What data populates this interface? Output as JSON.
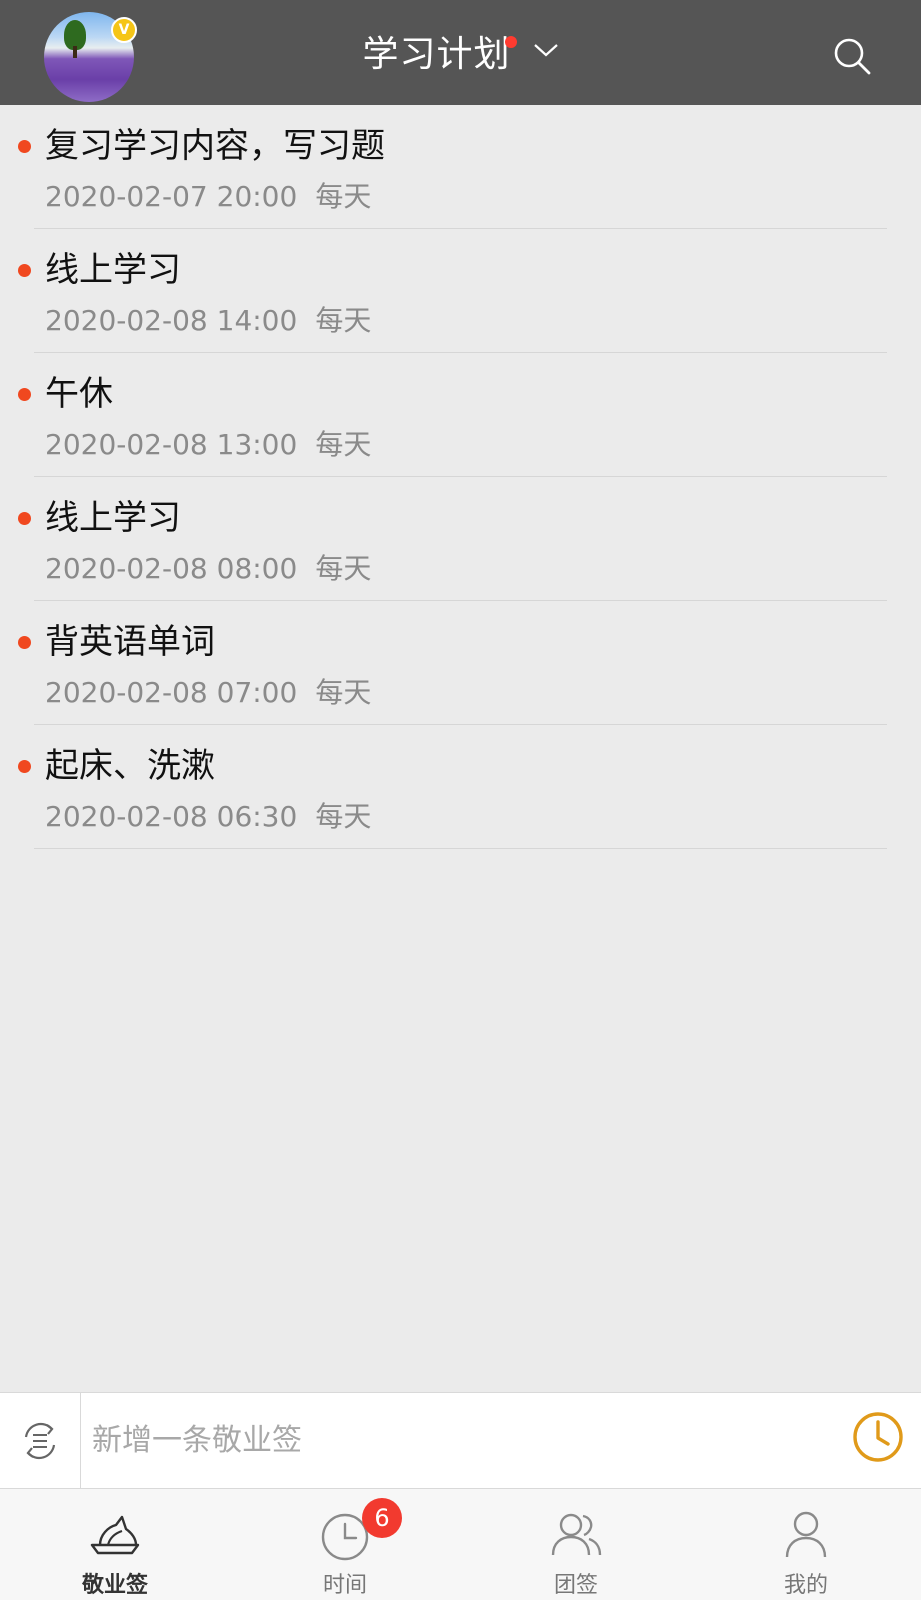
{
  "header": {
    "title": "学习计划",
    "vip_badge": "V"
  },
  "list": {
    "items": [
      {
        "title": "复习学习内容，写习题",
        "datetime": "2020-02-07 20:00",
        "repeat": "每天"
      },
      {
        "title": "线上学习",
        "datetime": "2020-02-08 14:00",
        "repeat": "每天"
      },
      {
        "title": "午休",
        "datetime": "2020-02-08 13:00",
        "repeat": "每天"
      },
      {
        "title": "线上学习",
        "datetime": "2020-02-08 08:00",
        "repeat": "每天"
      },
      {
        "title": "背英语单词",
        "datetime": "2020-02-08 07:00",
        "repeat": "每天"
      },
      {
        "title": "起床、洗漱",
        "datetime": "2020-02-08 06:30",
        "repeat": "每天"
      }
    ]
  },
  "input_bar": {
    "placeholder": "新增一条敬业签"
  },
  "tabbar": {
    "tabs": [
      {
        "label": "敬业签",
        "icon": "boat-icon",
        "active": true
      },
      {
        "label": "时间",
        "icon": "clock-icon",
        "badge": "6"
      },
      {
        "label": "团签",
        "icon": "group-icon"
      },
      {
        "label": "我的",
        "icon": "person-icon"
      }
    ]
  },
  "colors": {
    "header_bg": "#555555",
    "bullet": "#f0481f",
    "alarm": "#e09a1a",
    "badge": "#f23a2f"
  }
}
